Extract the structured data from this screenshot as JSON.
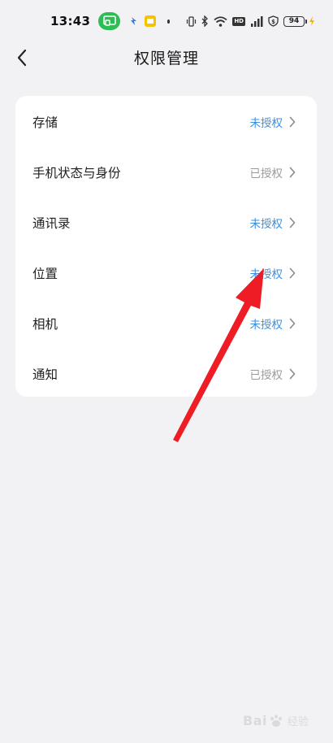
{
  "status_bar": {
    "time": "13:43",
    "battery_level": "94"
  },
  "header": {
    "title": "权限管理"
  },
  "permissions": [
    {
      "label": "存储",
      "status": "未授权",
      "state": "unauthorized"
    },
    {
      "label": "手机状态与身份",
      "status": "已授权",
      "state": "authorized"
    },
    {
      "label": "通讯录",
      "status": "未授权",
      "state": "unauthorized"
    },
    {
      "label": "位置",
      "status": "未授权",
      "state": "unauthorized"
    },
    {
      "label": "相机",
      "status": "未授权",
      "state": "unauthorized"
    },
    {
      "label": "通知",
      "status": "已授权",
      "state": "authorized"
    }
  ],
  "colors": {
    "unauthorized": "#3d8fdc",
    "authorized": "#9a9a9a",
    "annotation_arrow": "#ee1c25",
    "cast_pill": "#2ebd55"
  },
  "icons": {
    "back": "chevron-left-icon",
    "row_chevron": "chevron-right-icon"
  },
  "watermark": {
    "logo_text": "Bai",
    "sub_text": "经验"
  }
}
